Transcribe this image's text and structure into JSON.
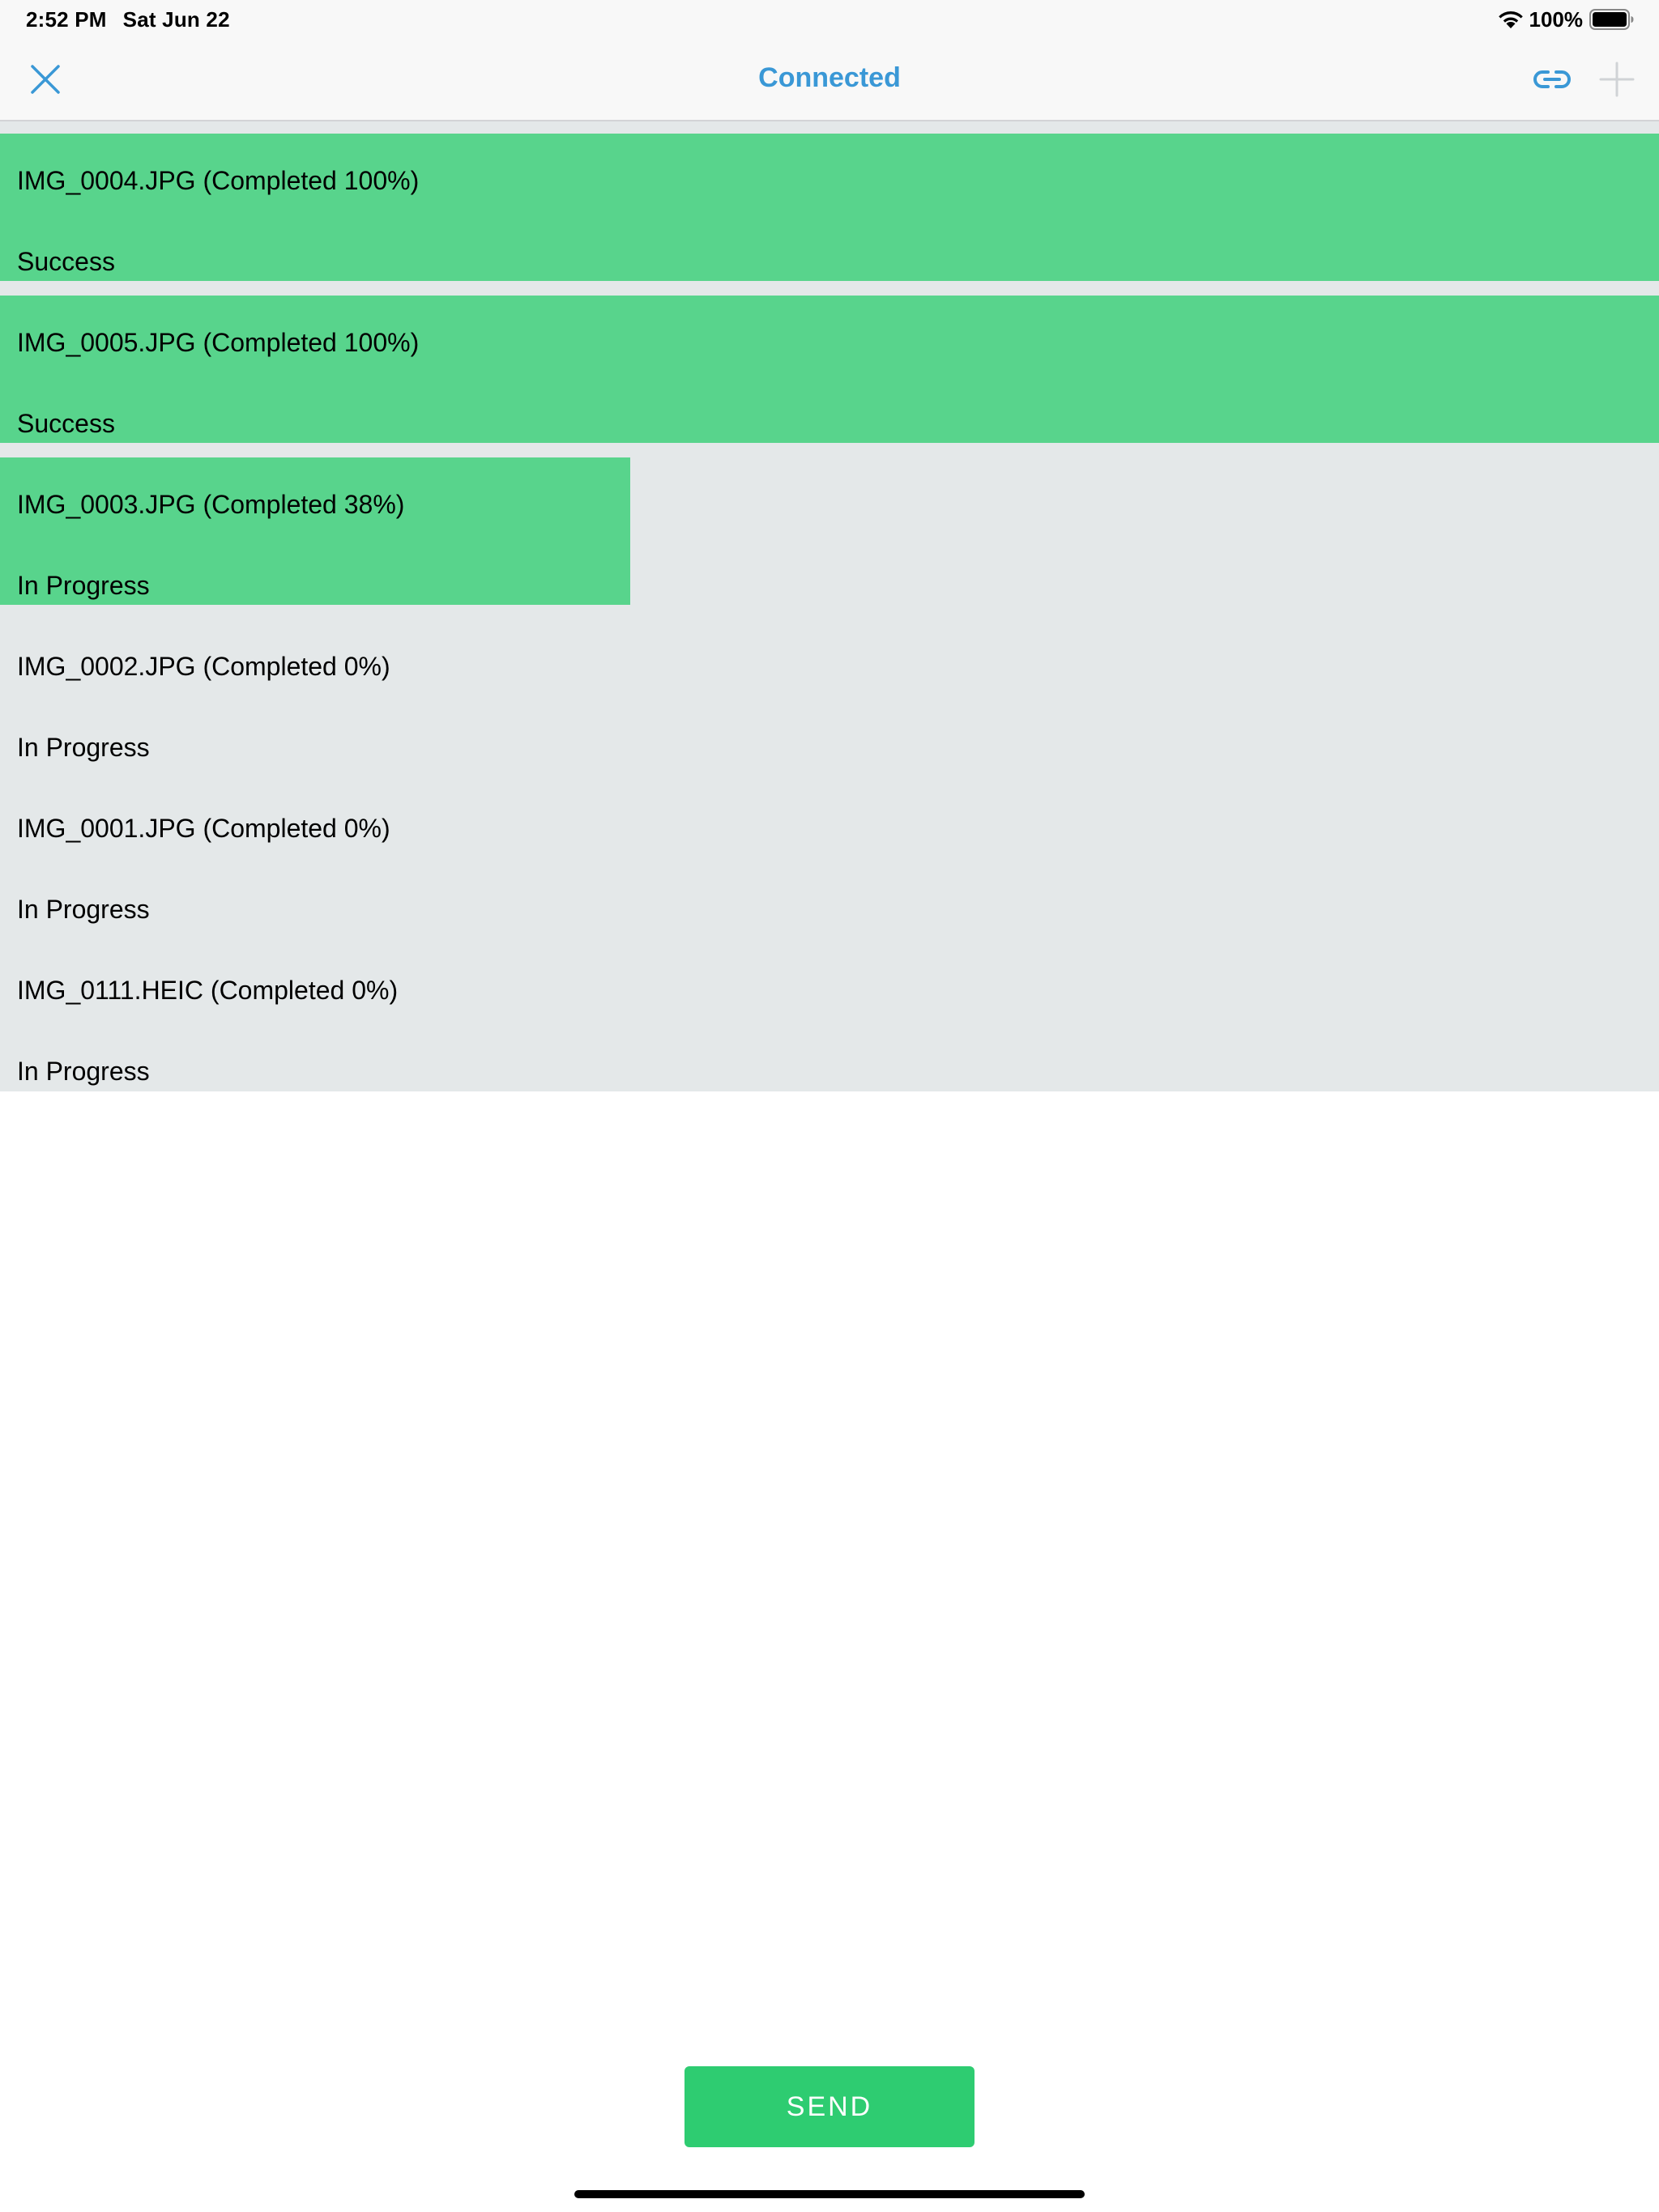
{
  "status_bar": {
    "time": "2:52 PM",
    "date": "Sat Jun 22",
    "battery_percent": "100%",
    "wifi_icon": "wifi-icon",
    "battery_icon": "battery-full-icon"
  },
  "nav": {
    "title": "Connected",
    "close_icon": "close-icon",
    "link_icon": "link-icon",
    "add_icon": "plus-icon",
    "add_enabled": false
  },
  "colors": {
    "accent": "#3a98d6",
    "progress_fill": "#58d48c",
    "list_background": "#e4e8e9",
    "send_button": "#2ecc71",
    "disabled_icon": "#d0d3d6"
  },
  "transfers": [
    {
      "title": "IMG_0004.JPG (Completed 100%)",
      "status": "Success",
      "progress": 1.0
    },
    {
      "title": "IMG_0005.JPG (Completed 100%)",
      "status": "Success",
      "progress": 1.0
    },
    {
      "title": "IMG_0003.JPG (Completed 38%)",
      "status": "In Progress",
      "progress": 0.38
    },
    {
      "title": "IMG_0002.JPG (Completed 0%)",
      "status": "In Progress",
      "progress": 0.0
    },
    {
      "title": "IMG_0001.JPG (Completed 0%)",
      "status": "In Progress",
      "progress": 0.0
    },
    {
      "title": "IMG_0111.HEIC (Completed 0%)",
      "status": "In Progress",
      "progress": 0.0
    }
  ],
  "send_button": {
    "label": "SEND"
  }
}
